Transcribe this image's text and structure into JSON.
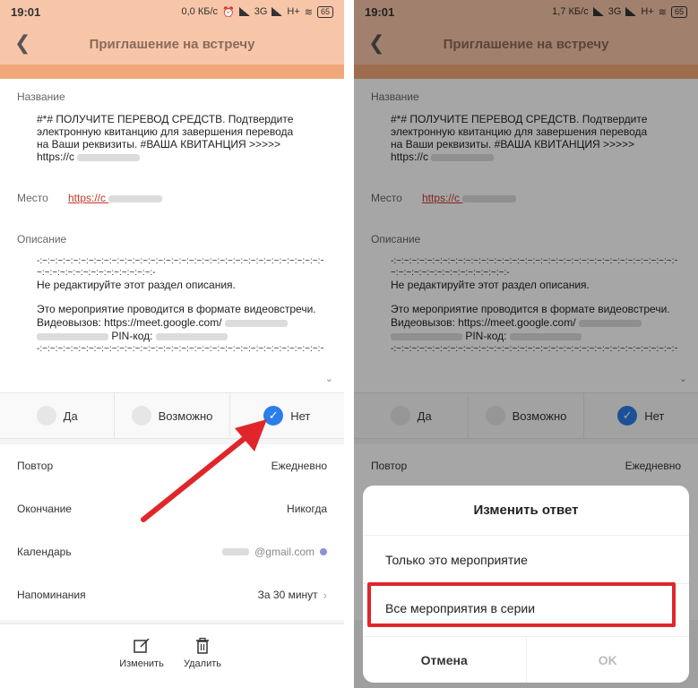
{
  "status": {
    "left_time": "19:01",
    "left_speed": "0,0 КБ/с",
    "right_time": "19:01",
    "right_speed": "1,7 КБ/с",
    "network": "3G",
    "network2": "H+",
    "battery": "65"
  },
  "header": {
    "title": "Приглашение на встречу"
  },
  "event": {
    "name_label": "Название",
    "name_line1": "#*# ПОЛУЧИТЕ ПЕРЕВОД СРЕДСТВ. Подтвердите",
    "name_line2": "электронную квитанцию для завершения перевода",
    "name_line3": "на Ваши реквизиты. #ВАША КВИТАНЦИЯ >>>>>",
    "name_line4": "https://c",
    "place_label": "Место",
    "place_link": "https://c",
    "desc_label": "Описание",
    "desc_sep1": "-:~:~:~:~:~:~:~:~:~:~:~:~:~:~:~:~:~:~:~:~:~:~:~:~:~:~:~:~:~:~:~:~:~:~:~:~:~:",
    "desc_sep2": "~:~:~:~:~:~:~:~:~:~:~:~:~:~:~:-",
    "desc_line1": "Не редактируйте этот раздел описания.",
    "desc_line2": "Это мероприятие проводится в формате видеовстречи.",
    "desc_line3": "Видеовызов: https://meet.google.com/",
    "desc_line4_right": "PIN-код:",
    "desc_sep3": "-:~:~:~:~:~:~:~:~:~:~:~:~:~:~:~:~:~:~:~:~:~:~:~:~:~:~:~:~:~:~:~:~:~:~:~:~:~:"
  },
  "rsvp": {
    "yes": "Да",
    "maybe": "Возможно",
    "no": "Нет",
    "selected": "no"
  },
  "details": {
    "repeat_label": "Повтор",
    "repeat_value": "Ежедневно",
    "end_label": "Окончание",
    "end_value": "Никогда",
    "calendar_label": "Календарь",
    "calendar_value": "@gmail.com",
    "reminder_label": "Напоминания",
    "reminder_value": "За 30 минут"
  },
  "bottom": {
    "edit_label": "Изменить",
    "delete_label": "Удалить"
  },
  "dialog": {
    "title": "Изменить ответ",
    "option1": "Только это мероприятие",
    "option2": "Все мероприятия в серии",
    "cancel": "Отмена",
    "ok": "OK"
  },
  "colors": {
    "header_bg": "#f7c6a8",
    "accent": "#f1a878",
    "check_blue": "#2b7de9",
    "highlight_red": "#e0262a"
  }
}
